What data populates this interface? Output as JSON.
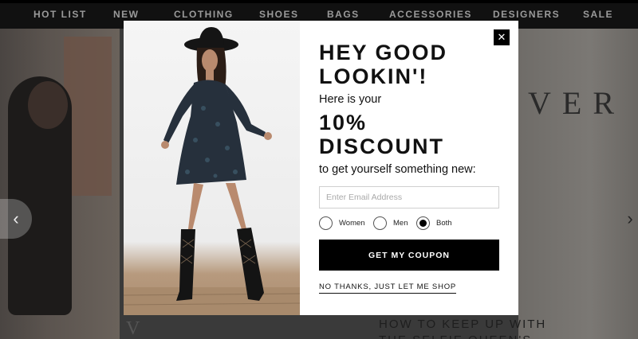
{
  "nav": {
    "items": [
      "HOT LIST",
      "NEW",
      "CLOTHING",
      "SHOES",
      "BAGS",
      "ACCESSORIES",
      "DESIGNERS",
      "SALE"
    ]
  },
  "background": {
    "right_letters": "VER",
    "left_caption": "V",
    "bottom_text_line1": "HOW TO KEEP UP WITH",
    "bottom_text_line2": "THE SELFIE QUEEN'S"
  },
  "carousel": {
    "prev_glyph": "‹",
    "next_glyph": "›"
  },
  "modal": {
    "close_glyph": "✕",
    "headline_line1": "HEY GOOD",
    "headline_line2": "LOOKIN'!",
    "subline": "Here is your",
    "discount_line1": "10%",
    "discount_line2": "DISCOUNT",
    "tagline": "to get yourself something new:",
    "email_placeholder": "Enter Email Address",
    "gender_options": [
      {
        "label": "Women",
        "selected": false
      },
      {
        "label": "Men",
        "selected": false
      },
      {
        "label": "Both",
        "selected": true
      }
    ],
    "cta_label": "GET MY COUPON",
    "dismiss_label": "NO THANKS, JUST LET ME SHOP"
  },
  "colors": {
    "nav_bg": "#111111",
    "cta_bg": "#000000",
    "modal_bg": "#ffffff"
  }
}
